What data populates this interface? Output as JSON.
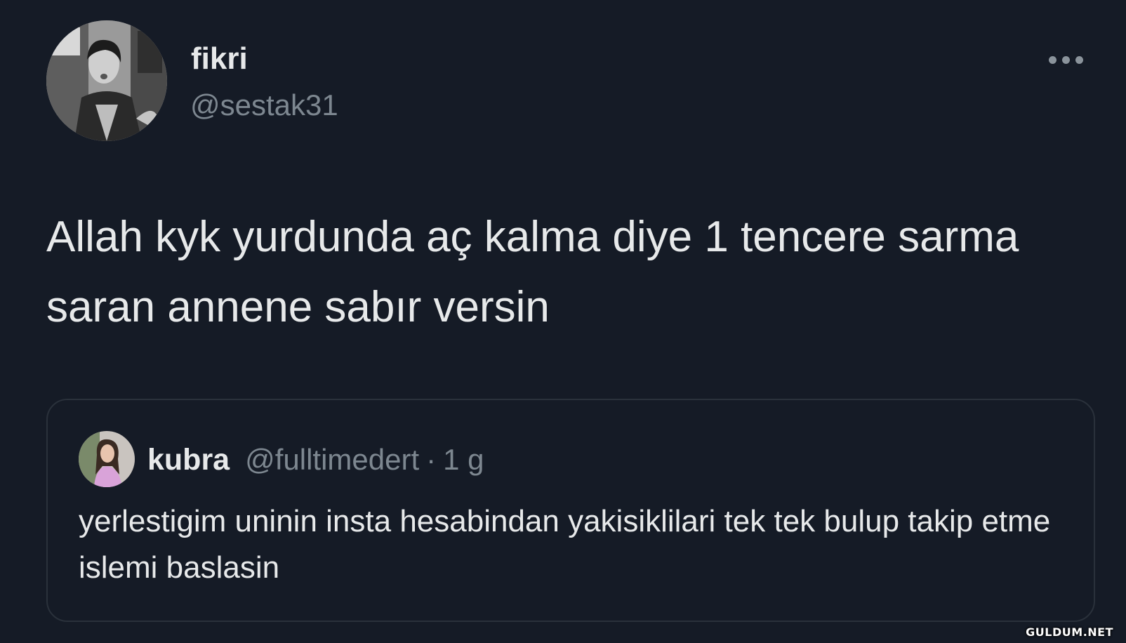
{
  "tweet": {
    "author": {
      "display_name": "fikri",
      "handle": "@sestak31",
      "avatar_icon": "avatar-photo-man-black-and-white"
    },
    "more_icon": "more-horizontal-icon",
    "text": "Allah kyk yurdunda aç kalma diye 1 tencere sarma saran annene sabır versin"
  },
  "quoted_tweet": {
    "author": {
      "display_name": "kubra",
      "handle": "@fulltimedert",
      "avatar_icon": "avatar-photo-woman"
    },
    "separator": "·",
    "time": "1 g",
    "text": "yerlestigim uninin insta hesabindan yakisiklilari tek tek bulup takip etme islemi baslasin"
  },
  "watermark": "GULDUM.NET",
  "colors": {
    "background": "#151b26",
    "primary_text": "#e7e9ea",
    "secondary_text": "#7d8790",
    "quote_border": "#2a313b"
  }
}
